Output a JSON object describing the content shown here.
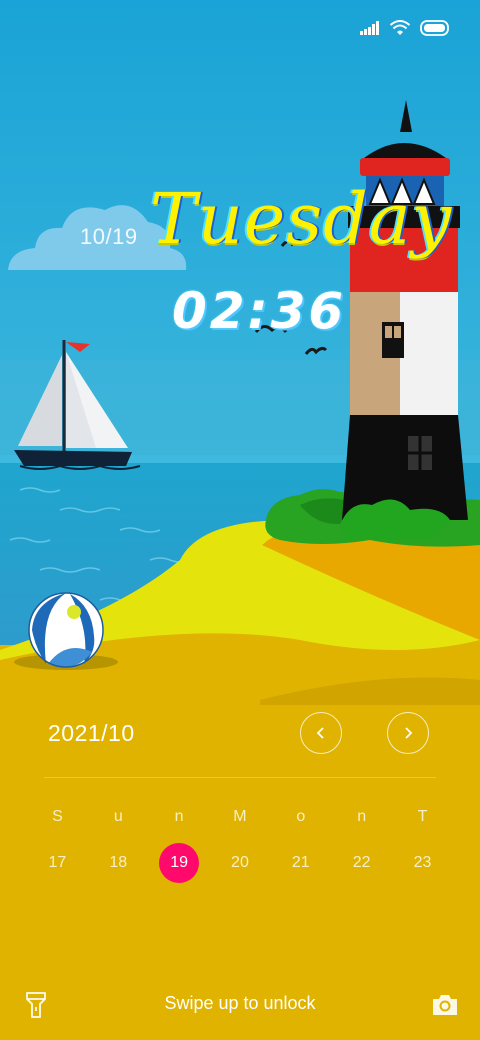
{
  "lockscreen": {
    "date_short": "10/19",
    "weekday": "Tuesday",
    "time": "02:36"
  },
  "calendar": {
    "month_label": "2021/10",
    "weekday_headers": [
      "S",
      "u",
      "n",
      "M",
      "o",
      "n",
      "T"
    ],
    "days": [
      "17",
      "18",
      "19",
      "20",
      "21",
      "22",
      "23"
    ],
    "today": "19",
    "today_color": "#ff0a6c"
  },
  "unlock": {
    "hint": "Swipe up to unlock"
  },
  "icons": {
    "status": [
      "signal-icon",
      "wifi-icon",
      "battery-icon"
    ],
    "left_shortcut": "flashlight-icon",
    "right_shortcut": "camera-icon",
    "prev": "chevron-left-icon",
    "next": "chevron-right-icon"
  },
  "colors": {
    "sky": "#27a9d6",
    "sea": "#24a0cf",
    "sand": "#e6e60c",
    "panel": "#e0b300"
  }
}
